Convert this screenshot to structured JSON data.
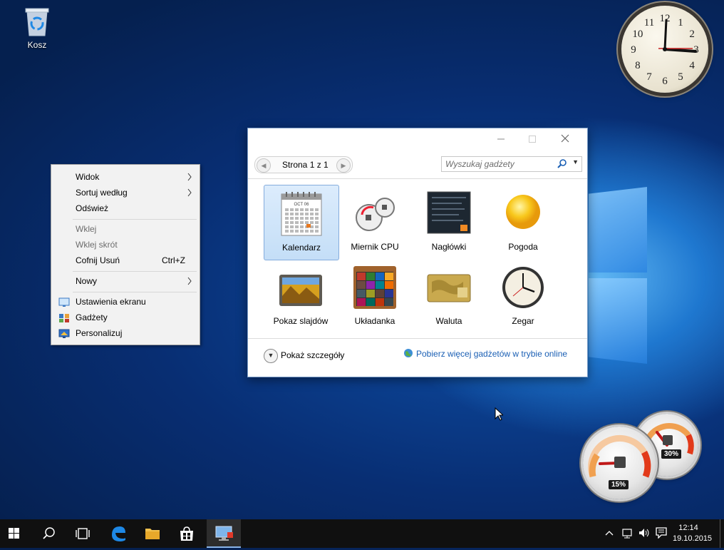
{
  "desktop": {
    "icons": [
      {
        "label": "Kosz",
        "icon": "recycle-bin-icon"
      }
    ]
  },
  "context_menu": {
    "items": [
      {
        "label": "Widok",
        "submenu": true,
        "disabled": false
      },
      {
        "label": "Sortuj według",
        "submenu": true,
        "disabled": false
      },
      {
        "label": "Odśwież",
        "disabled": false
      },
      {
        "label": "Wklej",
        "disabled": true
      },
      {
        "label": "Wklej skrót",
        "disabled": true
      },
      {
        "label": "Cofnij Usuń",
        "shortcut": "Ctrl+Z",
        "disabled": false
      },
      {
        "label": "Nowy",
        "submenu": true,
        "disabled": false
      },
      {
        "label": "Ustawienia ekranu",
        "icon": "display-settings-icon",
        "disabled": false
      },
      {
        "label": "Gadżety",
        "icon": "gadgets-icon",
        "disabled": false
      },
      {
        "label": "Personalizuj",
        "icon": "personalize-icon",
        "disabled": false
      }
    ]
  },
  "gadget_window": {
    "pager_text": "Strona 1 z 1",
    "search_placeholder": "Wyszukaj gadżety",
    "gadgets": [
      {
        "name": "Kalendarz",
        "selected": true
      },
      {
        "name": "Miernik CPU",
        "selected": false
      },
      {
        "name": "Nagłówki",
        "selected": false
      },
      {
        "name": "Pogoda",
        "selected": false
      },
      {
        "name": "Pokaz slajdów",
        "selected": false
      },
      {
        "name": "Układanka",
        "selected": false
      },
      {
        "name": "Waluta",
        "selected": false
      },
      {
        "name": "Zegar",
        "selected": false
      }
    ],
    "calendar_thumb_month": "OCT 06",
    "details_label": "Pokaż szczegóły",
    "online_link": "Pobierz więcej gadżetów w trybie online"
  },
  "clock_gadget": {
    "numerals": [
      "12",
      "1",
      "2",
      "3",
      "4",
      "5",
      "6",
      "7",
      "8",
      "9",
      "10",
      "11"
    ],
    "time": "12:14"
  },
  "cpu_gadget": {
    "cpu_percent": "15%",
    "memory_percent": "30%"
  },
  "taskbar": {
    "time": "12:14",
    "date": "19.10.2015"
  }
}
